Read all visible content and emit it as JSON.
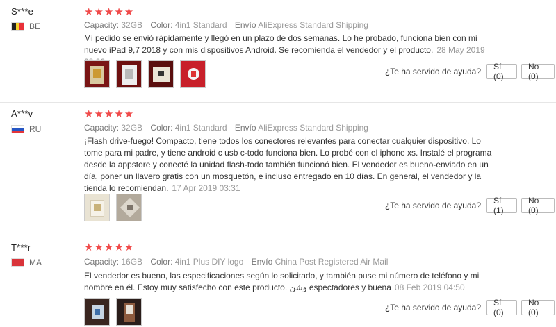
{
  "labels": {
    "capacity": "Capacity:",
    "color": "Color:",
    "shipping": "Envío",
    "helpful_question": "¿Te ha servido de ayuda?"
  },
  "reviews": [
    {
      "user": "S***e",
      "country": "BE",
      "rating": "★★★★★",
      "capacity": "32GB",
      "color": "4in1 Standard",
      "shipping": "AliExpress Standard Shipping",
      "text": "Mi pedido se envió rápidamente y llegó en un plazo de dos semanas. Lo he probado, funciona bien con mi nuevo iPad 9,7 2018 y con mis dispositivos Android. Se recomienda el vendedor y el producto.",
      "date": "28 May 2019 08:06",
      "yes": "Sí (0)",
      "no": "No (0)"
    },
    {
      "user": "A***v",
      "country": "RU",
      "rating": "★★★★★",
      "capacity": "32GB",
      "color": "4in1 Standard",
      "shipping": "AliExpress Standard Shipping",
      "text": "¡Flash drive-fuego! Compacto, tiene todos los conectores relevantes para conectar cualquier dispositivo. Lo tome para mi padre, y tiene android c usb c-todo funciona bien. Lo probé con el iphone xs. Instalé el programa desde la appstore y conecté la unidad flash-todo también funcionó bien. El vendedor es bueno-enviado en un día, poner un llavero gratis con un mosquetón, e incluso entregado en 10 días. En general, el vendedor y la tienda lo recomiendan.",
      "date": "17 Apr 2019 03:31",
      "yes": "Sí (1)",
      "no": "No (0)"
    },
    {
      "user": "T***r",
      "country": "MA",
      "rating": "★★★★★",
      "capacity": "16GB",
      "color": "4in1 Plus DIY logo",
      "shipping": "China Post Registered Air Mail",
      "text": "El vendedor es bueno, las especificaciones según lo solicitado, y también puse mi número de teléfono y mi nombre en él. Estoy muy satisfecho con este producto. وشن espectadores y buena",
      "date": "08 Feb 2019 04:50",
      "yes": "Sí (0)",
      "no": "No (0)"
    }
  ],
  "colors": {
    "star": "#f04a4a",
    "meta_gray": "#999999",
    "divider": "#e6e6e6"
  }
}
